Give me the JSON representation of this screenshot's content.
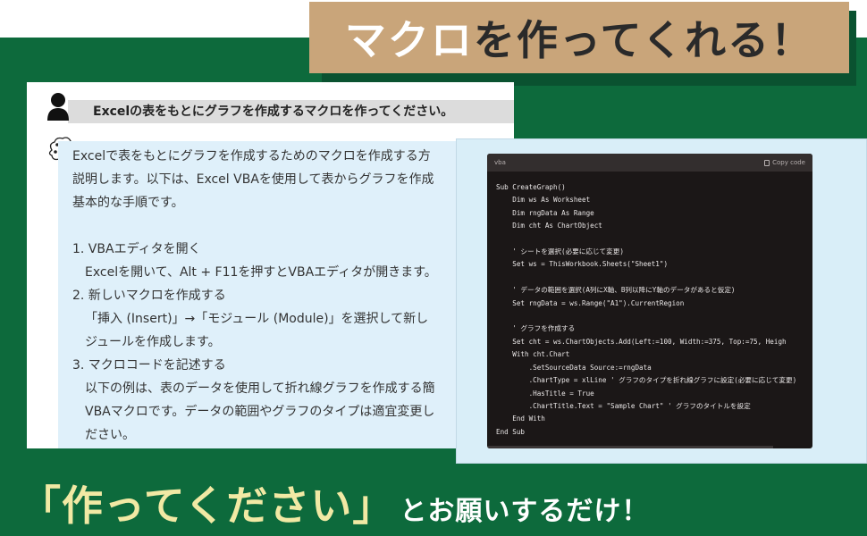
{
  "banner": {
    "title_highlight": "マクロ",
    "title_rest": "を作ってくれる！"
  },
  "chat": {
    "user_message": "Excelの表をもとにグラフを作成するマクロを作ってください。",
    "ai_lines": [
      "Excelで表をもとにグラフを作成するためのマクロを作成する方",
      "説明します。以下は、Excel VBAを使用して表からグラフを作成",
      "基本的な手順です。",
      "",
      "1. VBAエディタを開く",
      "Excelを開いて、Alt + F11を押すとVBAエディタが開きます。",
      "2. 新しいマクロを作成する",
      "「挿入 (Insert)」→「モジュール (Module)」を選択して新し",
      "ジュールを作成します。",
      "3. マクロコードを記述する",
      "以下の例は、表のデータを使用して折れ線グラフを作成する簡",
      "VBAマクロです。データの範囲やグラフのタイプは適宜変更し",
      "ださい。"
    ]
  },
  "code": {
    "language": "vba",
    "copy_label": "Copy code",
    "lines": [
      "Sub CreateGraph()",
      "    Dim ws As Worksheet",
      "    Dim rngData As Range",
      "    Dim cht As ChartObject",
      "",
      "    ' シートを選択(必要に応じて変更)",
      "    Set ws = ThisWorkbook.Sheets(\"Sheet1\")",
      "",
      "    ' データの範囲を選択(A列にX軸、B列以降にY軸のデータがあると仮定)",
      "    Set rngData = ws.Range(\"A1\").CurrentRegion",
      "",
      "    ' グラフを作成する",
      "    Set cht = ws.ChartObjects.Add(Left:=100, Width:=375, Top:=75, Heigh",
      "    With cht.Chart",
      "        .SetSourceData Source:=rngData",
      "        .ChartType = xlLine ' グラフのタイプを折れ線グラフに設定(必要に応じて変更)",
      "        .HasTitle = True",
      "        .ChartTitle.Text = \"Sample Chart\" ' グラフのタイトルを設定",
      "    End With",
      "End Sub"
    ]
  },
  "bottom": {
    "highlight": "「作ってください」",
    "rest": "とお願いするだけ！"
  }
}
